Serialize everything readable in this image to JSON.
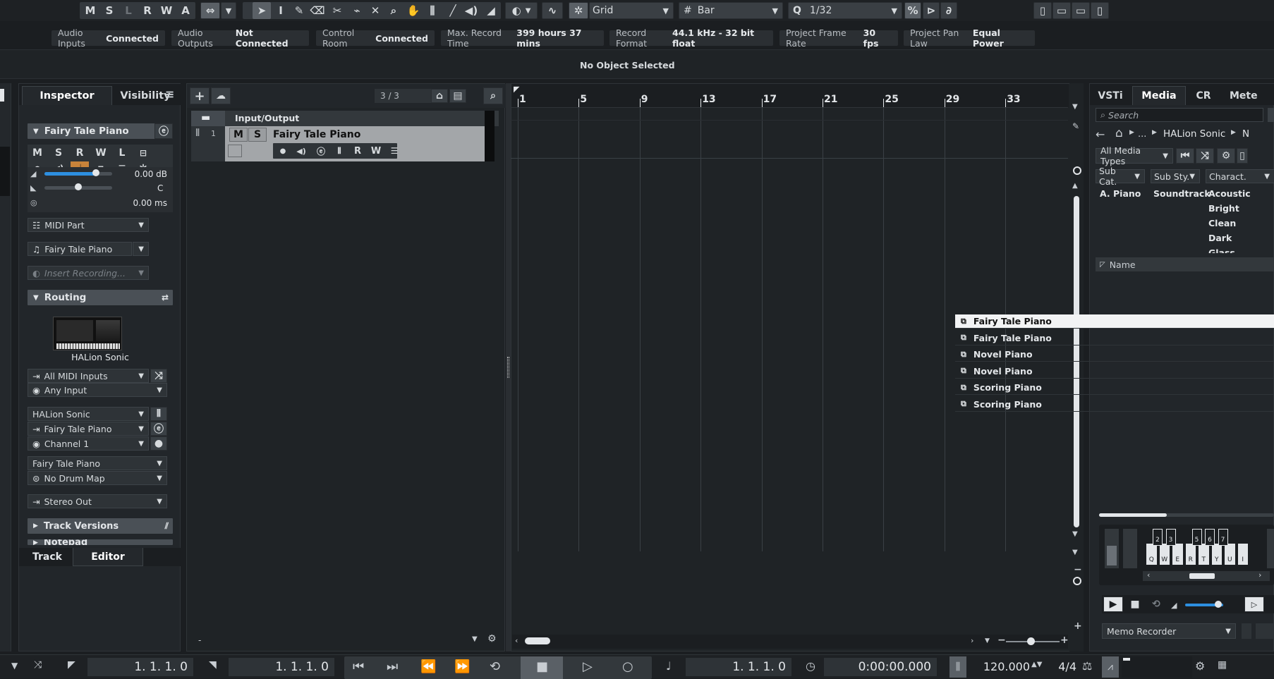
{
  "toolbar": {
    "modes": [
      "M",
      "S",
      "L",
      "R",
      "W",
      "A"
    ],
    "snap_type": "Grid",
    "grid_type": "Bar",
    "quantize": "1/32"
  },
  "status_line": [
    {
      "label": "Audio Inputs",
      "value": "Connected"
    },
    {
      "label": "Audio Outputs",
      "value": "Not Connected"
    },
    {
      "label": "Control Room",
      "value": "Connected"
    },
    {
      "label": "Max. Record Time",
      "value": "399 hours 37 mins"
    },
    {
      "label": "Record Format",
      "value": "44.1 kHz - 32 bit float"
    },
    {
      "label": "Project Frame Rate",
      "value": "30 fps"
    },
    {
      "label": "Project Pan Law",
      "value": "Equal Power"
    }
  ],
  "info_line": "No Object Selected",
  "inspector": {
    "tabs": [
      "Inspector",
      "Visibility"
    ],
    "track_name": "Fairy Tale Piano",
    "btn_row1": [
      "M",
      "S",
      "R",
      "W",
      "L"
    ],
    "volume": "0.00 dB",
    "volume_level": 0.8,
    "pan": "C",
    "delay": "0.00 ms",
    "part_type": "MIDI Part",
    "instrument_preset": "Fairy Tale Piano",
    "insert_recording_placeholder": "Insert Recording...",
    "routing_label": "Routing",
    "instrument_name": "HALion Sonic",
    "midi_input": "All MIDI Inputs",
    "any_input": "Any Input",
    "output_instrument": "HALion Sonic",
    "output_preset": "Fairy Tale Piano",
    "channel": "Channel 1",
    "program": "Fairy Tale Piano",
    "drum_map": "No Drum Map",
    "audio_out": "Stereo Out",
    "track_versions": "Track Versions",
    "notepad": "Notepad",
    "bottom_tabs": [
      "Track",
      "Editor"
    ]
  },
  "tracklist": {
    "count": "3 / 3",
    "folder_name": "Input/Output",
    "track_number": "1",
    "track_name": "Fairy Tale Piano",
    "track_btns": [
      "M",
      "S"
    ],
    "track_btns2": [
      "R",
      "W"
    ]
  },
  "ruler": [
    "1",
    "5",
    "9",
    "13",
    "17",
    "21",
    "25",
    "29",
    "33"
  ],
  "media": {
    "tabs": [
      "VSTi",
      "Media",
      "CR",
      "Mete"
    ],
    "search_placeholder": "Search",
    "breadcrumb": [
      "...",
      "HALion Sonic",
      "N"
    ],
    "type_filter": "All Media Types",
    "filter_headers": [
      "Sub Cat.",
      "Sub Sty.",
      "Charact."
    ],
    "filter_col1": [
      "A. Piano"
    ],
    "filter_col2": [
      "Soundtrack"
    ],
    "filter_col3": [
      "Acoustic",
      "Bright",
      "Clean",
      "Dark",
      "Glass"
    ],
    "name_header": "Name",
    "results": [
      "Fairy Tale Piano",
      "Fairy Tale Piano",
      "Novel Piano",
      "Novel Piano",
      "Scoring Piano",
      "Scoring Piano"
    ],
    "key_numbers": [
      "2",
      "3",
      "5",
      "6",
      "7"
    ],
    "key_letters": [
      "Q",
      "W",
      "E",
      "R",
      "T",
      "Y",
      "U",
      "I"
    ],
    "memo_recorder": "Memo Recorder"
  },
  "transport": {
    "left_locator": "1. 1. 1.   0",
    "right_locator": "1. 1. 1.   0",
    "position": "1. 1. 1.   0",
    "time": "0:00:00.000",
    "tempo": "120.000",
    "signature": "4/4"
  },
  "colors": {
    "accent": "#2d8fe0",
    "selected_tab": "#ffffff",
    "record_active": "#c8833a"
  }
}
